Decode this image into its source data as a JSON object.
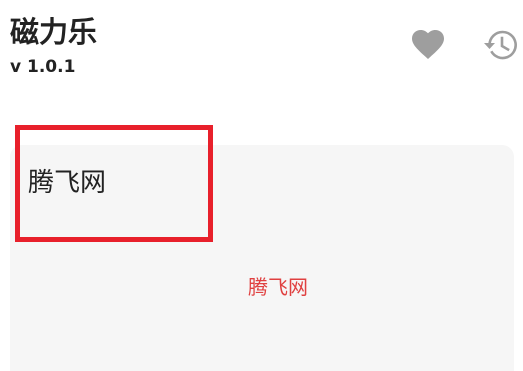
{
  "header": {
    "app_title": "磁力乐",
    "version": "v 1.0.1",
    "favorite_icon": "heart-icon",
    "history_icon": "history-icon",
    "icon_color": "#9e9e9e"
  },
  "card": {
    "site_title": "腾飞网",
    "site_link": "腾飞网",
    "link_color": "#e04040",
    "highlight_color": "#e8202b"
  }
}
